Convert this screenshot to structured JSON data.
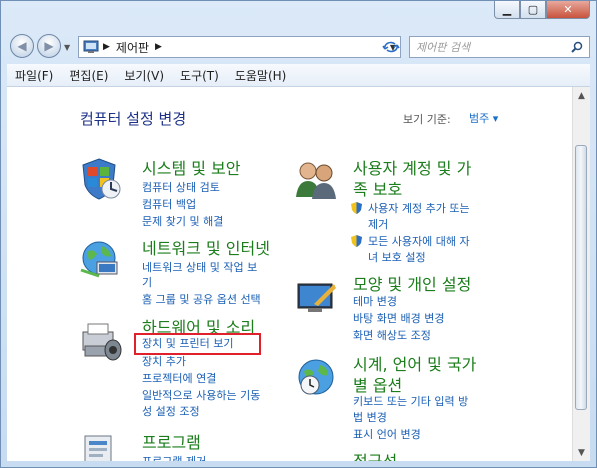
{
  "address": {
    "path": "제어판"
  },
  "search": {
    "placeholder": "제어판 검색"
  },
  "menu": [
    "파일(F)",
    "편집(E)",
    "보기(V)",
    "도구(T)",
    "도움말(H)"
  ],
  "page": {
    "title": "컴퓨터 설정 변경",
    "viewby_label": "보기 기준:",
    "viewby_value": "범주 ▾"
  },
  "categories": {
    "system": {
      "title": "시스템 및 보안",
      "links": [
        "컴퓨터 상태 검토",
        "컴퓨터 백업",
        "문제 찾기 및 해결"
      ]
    },
    "network": {
      "title": "네트워크 및 인터넷",
      "links": [
        "네트워크 상태 및 작업 보",
        "기",
        "홈 그룹 및 공유 옵션 선택"
      ]
    },
    "hardware": {
      "title": "하드웨어 및 소리",
      "links": [
        "장치 및 프린터 보기",
        "장치 추가",
        "프로젝터에 연결",
        "일반적으로 사용하는 기동",
        "성 설정 조정"
      ]
    },
    "programs": {
      "title": "프로그램",
      "links": [
        "프로그램 제거"
      ]
    },
    "users": {
      "title_line1": "사용자 계정 및 가",
      "title_line2": "족 보호",
      "links": [
        "사용자 계정 추가 또는",
        "제거",
        "모든 사용자에 대해 자",
        "녀 보호 설정"
      ]
    },
    "appearance": {
      "title": "모양 및 개인 설정",
      "links": [
        "테마 변경",
        "바탕 화면 배경 변경",
        "화면 해상도 조정"
      ]
    },
    "clock": {
      "title_line1": "시계, 언어 및 국가",
      "title_line2": "별 옵션",
      "links": [
        "키보드 또는 기타 입력 방",
        "법 변경",
        "표시 언어 변경"
      ]
    },
    "access": {
      "title": "접근성"
    }
  }
}
